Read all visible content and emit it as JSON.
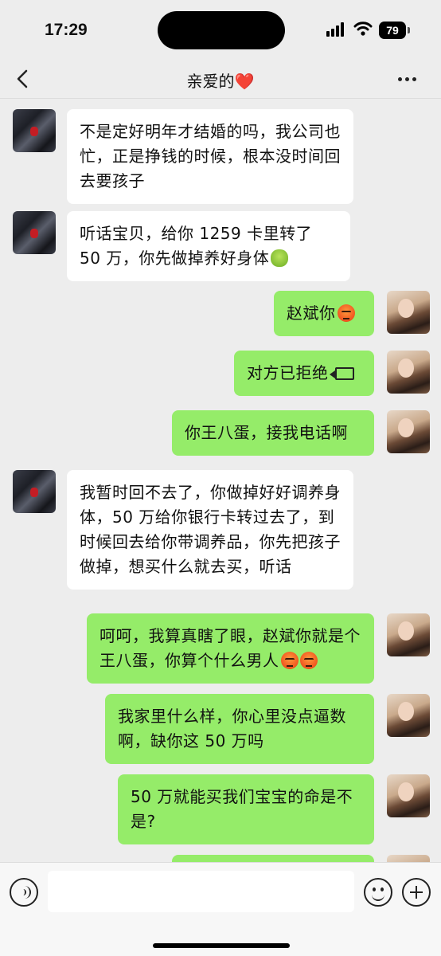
{
  "status_bar": {
    "time": "17:29",
    "battery": "79"
  },
  "nav": {
    "title": "亲爱的",
    "title_emoji": "❤️"
  },
  "messages": [
    {
      "side": "left",
      "text": "不是定好明年才结婚的吗，我公司也忙，正是挣钱的时候，根本没时间回去要孩子"
    },
    {
      "side": "left",
      "text": "听话宝贝，给你 1259 卡里转了 50 万，你先做掉养好身体",
      "emoji": "vomit-face-icon"
    },
    {
      "side": "right",
      "text": "赵斌你",
      "emoji": "angry-face-icon"
    },
    {
      "side": "right",
      "text": "对方已拒绝",
      "icon": "video-call-icon"
    },
    {
      "side": "right",
      "text": "你王八蛋，接我电话啊"
    },
    {
      "side": "left",
      "text": "我暂时回不去了，你做掉好好调养身体，50 万给你银行卡转过去了，到时候回去给你带调养品，你先把孩子做掉，想买什么就去买，听话"
    },
    {
      "side": "right",
      "text": "呵呵，我算真瞎了眼，赵斌你就是个王八蛋，你算个什么男人",
      "emoji": "angry-face-icon x2"
    },
    {
      "side": "right",
      "text": "我家里什么样，你心里没点逼数啊，缺你这 50 万吗"
    },
    {
      "side": "right",
      "text": "50 万就能买我们宝宝的命是不是?"
    }
  ],
  "colors": {
    "background": "#ededed",
    "bubble_self": "#95ec69",
    "bubble_other": "#ffffff"
  }
}
